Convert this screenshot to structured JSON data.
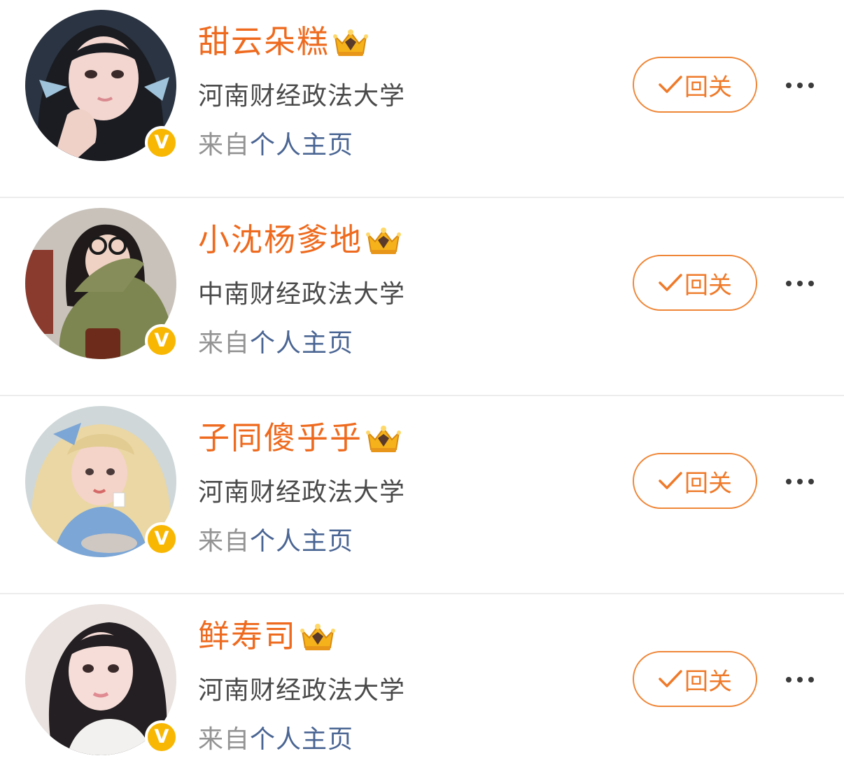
{
  "followers": [
    {
      "name": "甜云朵糕",
      "school": "河南财经政法大学",
      "source_prefix": "来自",
      "source_link": "个人主页",
      "follow_label": "回关",
      "avatar": {
        "bg": "#2b3442",
        "hair": "#1a1c22",
        "skin": "#f3d6cf",
        "clothes": "#9fc3da"
      }
    },
    {
      "name": "小沈杨爹地",
      "school": "中南财经政法大学",
      "source_prefix": "来自",
      "source_link": "个人主页",
      "follow_label": "回关",
      "avatar": {
        "bg": "#c8c2bb",
        "hair": "#201b1a",
        "skin": "#efd2c4",
        "clothes": "#7d8550"
      }
    },
    {
      "name": "子同傻乎乎",
      "school": "河南财经政法大学",
      "source_prefix": "来自",
      "source_link": "个人主页",
      "follow_label": "回关",
      "avatar": {
        "bg": "#cfd7d8",
        "hair": "#ead7a4",
        "skin": "#f4d4c8",
        "clothes": "#7ba6d6"
      }
    },
    {
      "name": "鲜寿司",
      "school": "河南财经政法大学",
      "source_prefix": "来自",
      "source_link": "个人主页",
      "follow_label": "回关",
      "avatar": {
        "bg": "#e9e2df",
        "hair": "#241f22",
        "skin": "#f6ddd8",
        "clothes": "#f3f1ef"
      }
    }
  ],
  "colors": {
    "name": "#ee6a1e",
    "button_border": "#ef8637",
    "link": "#4a6593",
    "badge": "#f8b703"
  },
  "icons": {
    "verified": "v-badge-icon",
    "crown": "crown-icon",
    "check": "check-icon",
    "more": "more-icon"
  }
}
